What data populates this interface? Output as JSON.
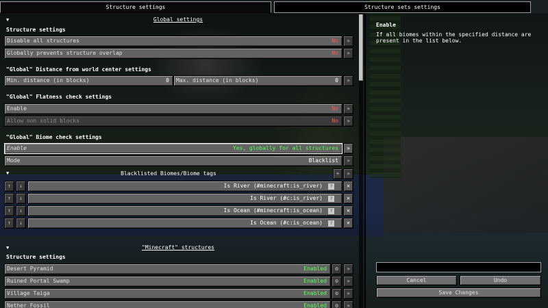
{
  "tabs": {
    "structure_settings": "Structure settings",
    "structure_sets_settings": "Structure sets settings"
  },
  "global_section": {
    "title": "Global settings",
    "structure_settings_heading": "Structure settings",
    "disable_all_structures": {
      "label": "Disable all structures",
      "value": "No"
    },
    "prevent_overlap": {
      "label": "Globally prevents structure overlap",
      "value": "No"
    },
    "distance_heading": "\"Global\" Distance from world center settings",
    "min_distance": {
      "label": "Min. distance (in blocks)",
      "value": "0"
    },
    "max_distance": {
      "label": "Max. distance (in blocks)",
      "value": "0"
    },
    "flatness_heading": "\"Global\" Flatness check settings",
    "flatness_enable": {
      "label": "Enable",
      "value": "No"
    },
    "allow_non_solid": {
      "label": "Allow non solid blocks",
      "value": "No"
    },
    "biome_heading": "\"Global\" Biome check settings",
    "biome_enable": {
      "label": "Enable",
      "value": "Yes, globally for all structures"
    },
    "mode": {
      "label": "Mode",
      "value": "Blacklist"
    },
    "blacklist_header": "Blacklisted Biomes/Biome tags",
    "add_symbol": "+",
    "tags": [
      "Is River (#minecraft:is_river)",
      "Is River (#c:is_river)",
      "Is Ocean (#minecraft:is_ocean)",
      "Is Ocean (#c:is_ocean)"
    ]
  },
  "minecraft_section": {
    "title": "\"Minecraft\" structures",
    "structure_settings_heading": "Structure settings",
    "structures": [
      {
        "name": "Desert Pyramid",
        "status": "Enabled"
      },
      {
        "name": "Ruined Portal Swamp",
        "status": "Enabled"
      },
      {
        "name": "Village Taiga",
        "status": "Enabled"
      },
      {
        "name": "Nether Fossil",
        "status": "Enabled"
      }
    ]
  },
  "symbols": {
    "reset": "»",
    "up": "↑",
    "down": "↓",
    "remove": "✕",
    "gear": "⚙",
    "chevron": "▼",
    "question": "?"
  },
  "help_panel": {
    "title": "Enable",
    "text": "If all biomes within the specified distance are present in the list below."
  },
  "bottom_controls": {
    "search_value": "",
    "cancel": "Cancel",
    "undo": "Undo",
    "save": "Save Changes"
  },
  "colors": {
    "no": "#ff5555",
    "yes": "#55ff55",
    "panel": "#000000"
  }
}
